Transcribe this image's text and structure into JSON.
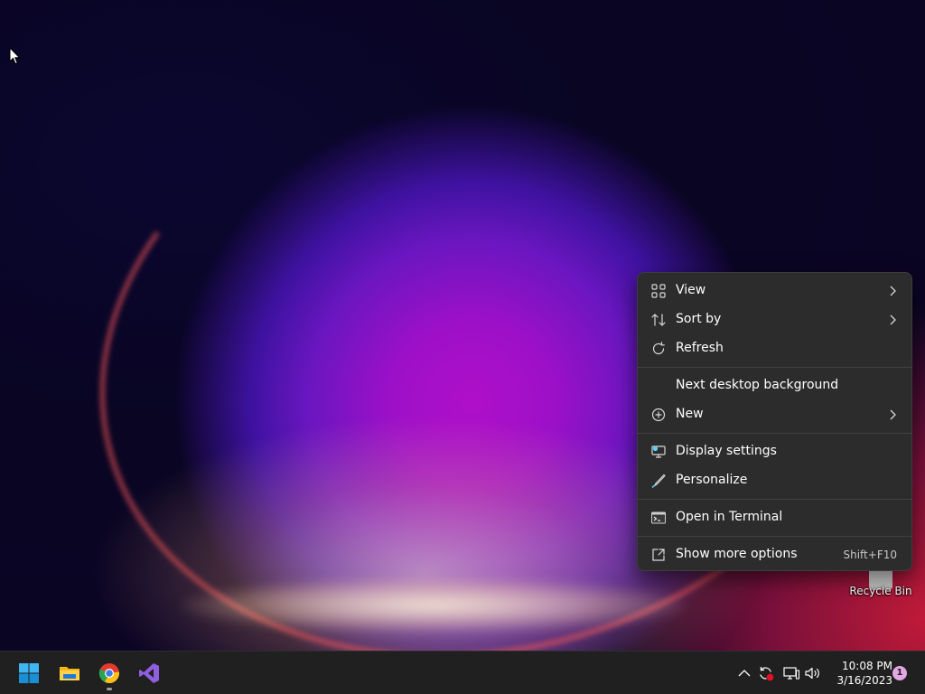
{
  "desktop": {
    "icons": [
      {
        "label": "Recycle Bin",
        "icon": "recycle-bin-icon"
      }
    ]
  },
  "context_menu": {
    "groups": [
      [
        {
          "label": "View",
          "icon": "view-grid-icon",
          "submenu": true
        },
        {
          "label": "Sort by",
          "icon": "sort-icon",
          "submenu": true
        },
        {
          "label": "Refresh",
          "icon": "refresh-icon",
          "submenu": false
        }
      ],
      [
        {
          "label": "Next desktop background",
          "icon": "",
          "submenu": false
        },
        {
          "label": "New",
          "icon": "new-plus-icon",
          "submenu": true
        }
      ],
      [
        {
          "label": "Display settings",
          "icon": "display-settings-icon",
          "submenu": false
        },
        {
          "label": "Personalize",
          "icon": "personalize-brush-icon",
          "submenu": false
        }
      ],
      [
        {
          "label": "Open in Terminal",
          "icon": "terminal-icon",
          "submenu": false
        }
      ],
      [
        {
          "label": "Show more options",
          "icon": "show-more-options-icon",
          "submenu": false,
          "shortcut": "Shift+F10"
        }
      ]
    ]
  },
  "taskbar": {
    "apps": [
      {
        "name": "Start",
        "icon": "windows-start-icon"
      },
      {
        "name": "File Explorer",
        "icon": "file-explorer-icon"
      },
      {
        "name": "Google Chrome",
        "icon": "chrome-icon",
        "running": true
      },
      {
        "name": "Visual Studio",
        "icon": "visual-studio-icon"
      }
    ],
    "tray": {
      "icons": [
        "show-hidden-icons-chevron",
        "sync-error-icon",
        "network-icon",
        "volume-icon"
      ],
      "time": "10:08 PM",
      "date": "3/16/2023",
      "notification_count": "1"
    }
  },
  "colors": {
    "menu_background": "#2c2c2c",
    "taskbar_background": "#202020",
    "accent": "#60cdff",
    "notification_badge": "#e3a8e3"
  }
}
